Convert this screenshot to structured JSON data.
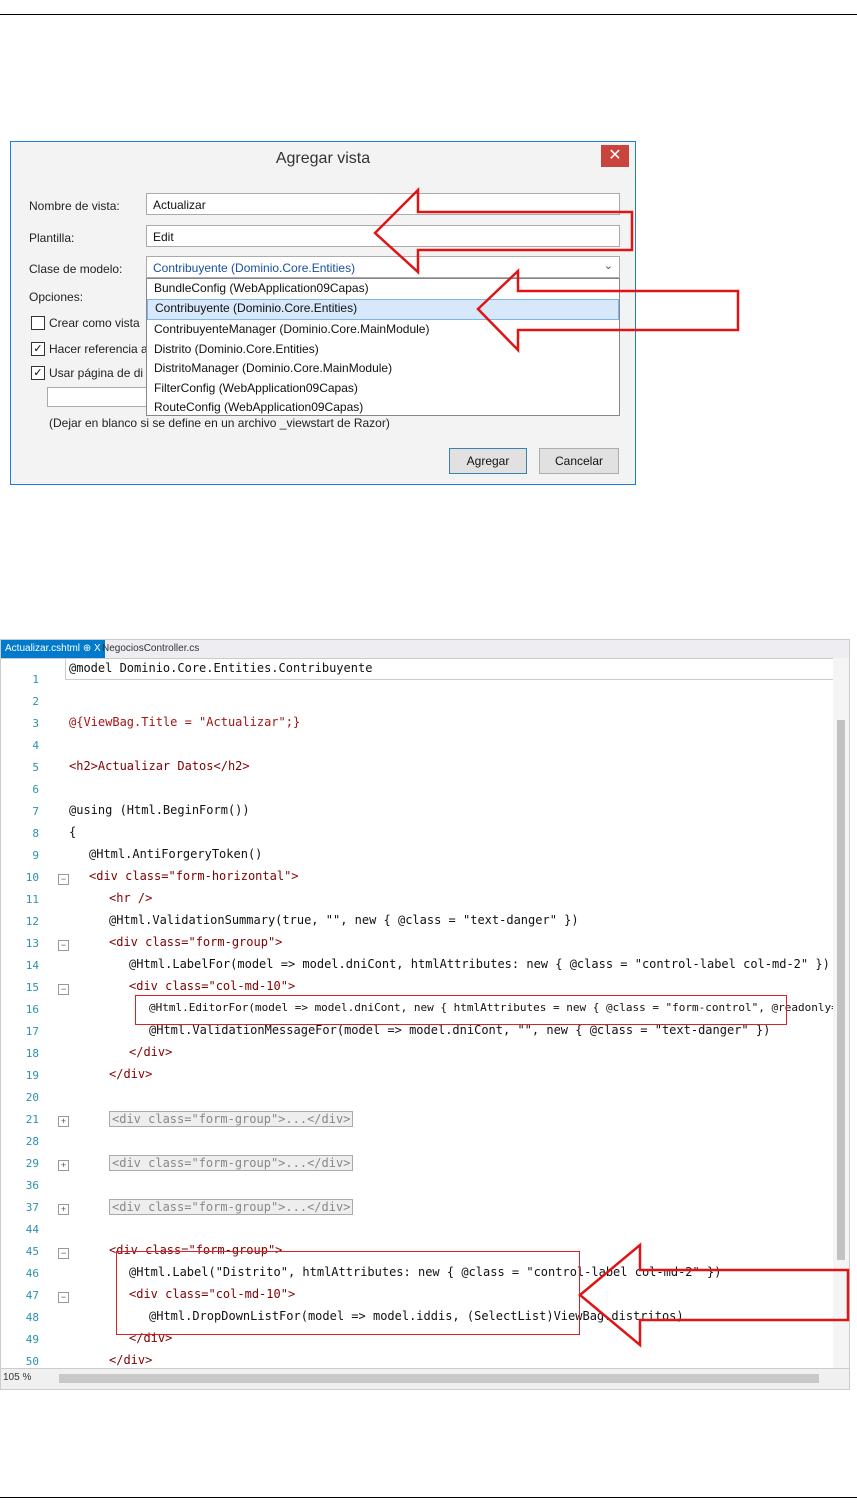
{
  "dialog": {
    "title": "Agregar vista",
    "close_glyph": "✕",
    "view_name_label": "Nombre de vista:",
    "view_name_value": "Actualizar",
    "template_label": "Plantilla:",
    "template_value": "Edit",
    "model_class_label": "Clase de modelo:",
    "model_class_value": "Contribuyente (Dominio.Core.Entities)",
    "model_class_options": [
      "BundleConfig (WebApplication09Capas)",
      "Contribuyente (Dominio.Core.Entities)",
      "ContribuyenteManager (Dominio.Core.MainModule)",
      "Distrito (Dominio.Core.Entities)",
      "DistritoManager (Dominio.Core.MainModule)",
      "FilterConfig (WebApplication09Capas)",
      "RouteConfig (WebApplication09Capas)"
    ],
    "options_label": "Opciones:",
    "opt_partial": "Crear como vista",
    "opt_reference": "Hacer referencia a",
    "opt_layout": "Usar página de di",
    "check_mark": "✓",
    "layout_hint": "(Dejar en blanco si se define en un archivo _viewstart de Razor)",
    "add_button": "Agregar",
    "cancel_button": "Cancelar"
  },
  "editor": {
    "tab_active": "Actualizar.cshtml",
    "tab_active_marks": "⊕ X",
    "tab_inactive": "NegociosController.cs",
    "zoom": "105 %",
    "line_numbers": [
      "1",
      "2",
      "3",
      "4",
      "5",
      "6",
      "7",
      "8",
      "9",
      "10",
      "11",
      "12",
      "13",
      "14",
      "15",
      "16",
      "17",
      "18",
      "19",
      "20",
      "21",
      "28",
      "29",
      "36",
      "37",
      "44",
      "45",
      "46",
      "47",
      "48",
      "49",
      "50"
    ],
    "lines": {
      "l1": "@model Dominio.Core.Entities.Contribuyente",
      "l3": "@{ViewBag.Title = \"Actualizar\";}",
      "l5": "<h2>Actualizar Datos</h2>",
      "l7": "@using (Html.BeginForm())",
      "l8": "{",
      "l9": "@Html.AntiForgeryToken()",
      "l10": "<div class=\"form-horizontal\">",
      "l11": "<hr />",
      "l12": "@Html.ValidationSummary(true, \"\", new { @class = \"text-danger\" })",
      "l13": "<div class=\"form-group\">",
      "l14": "@Html.LabelFor(model => model.dniCont, htmlAttributes: new { @class = \"control-label col-md-2\" })",
      "l15": "<div class=\"col-md-10\">",
      "l16": "@Html.EditorFor(model => model.dniCont, new { htmlAttributes = new { @class = \"form-control\", @readonly=\"readonly\" } })",
      "l17": "@Html.ValidationMessageFor(model => model.dniCont, \"\", new { @class = \"text-danger\" })",
      "l18": "</div>",
      "l19": "</div>",
      "l21": "<div class=\"form-group\">...</div>",
      "l29": "<div class=\"form-group\">...</div>",
      "l37": "<div class=\"form-group\">...</div>",
      "l45": "<div class=\"form-group\">",
      "l46": "@Html.Label(\"Distrito\", htmlAttributes: new { @class = \"control-label col-md-2\" })",
      "l47": "<div class=\"col-md-10\">",
      "l48": "@Html.DropDownListFor(model => model.iddis, (SelectList)ViewBag.distritos)",
      "l49": "</div>",
      "l50": "</div>"
    }
  }
}
